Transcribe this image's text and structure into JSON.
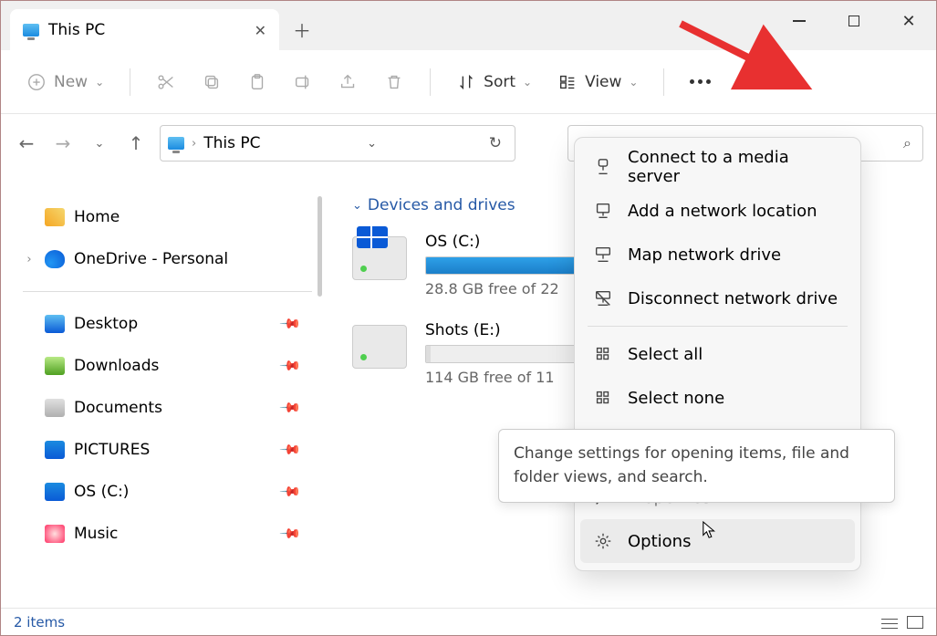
{
  "tab": {
    "title": "This PC"
  },
  "toolbar": {
    "new": "New",
    "sort": "Sort",
    "view": "View"
  },
  "address": {
    "crumb": "This PC"
  },
  "sidebar": {
    "home": "Home",
    "onedrive": "OneDrive - Personal",
    "items": [
      {
        "label": "Desktop"
      },
      {
        "label": "Downloads"
      },
      {
        "label": "Documents"
      },
      {
        "label": "PICTURES"
      },
      {
        "label": "OS (C:)"
      },
      {
        "label": "Music"
      }
    ]
  },
  "main": {
    "group": "Devices and drives",
    "drives": [
      {
        "name": "OS (C:)",
        "free": "28.8 GB free of 22",
        "fill": 88
      },
      {
        "name": "Shots (E:)",
        "free": "114 GB free of 11",
        "fill": 2
      }
    ]
  },
  "menu": {
    "items": [
      {
        "label": "Connect to a media server"
      },
      {
        "label": "Add a network location"
      },
      {
        "label": "Map network drive"
      },
      {
        "label": "Disconnect network drive"
      }
    ],
    "select_all": "Select all",
    "select_none": "Select none",
    "properties": "Properties",
    "options": "Options"
  },
  "tooltip": "Change settings for opening items, file and folder views, and search.",
  "status": {
    "count": "2 items"
  }
}
